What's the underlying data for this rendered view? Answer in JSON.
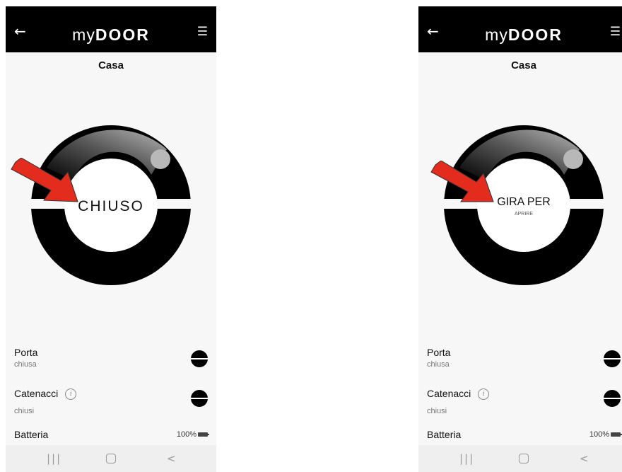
{
  "screens": [
    {
      "header": {
        "logo_lo": "my",
        "logo_hi": "DOOR",
        "back_icon": "arrow-left-icon",
        "menu_icon": "hamburger-menu-icon"
      },
      "title": "Casa",
      "dial": {
        "center_main": "CHIUSO",
        "center_sub": ""
      },
      "status": {
        "door_label": "Porta",
        "door_value": "chiusa",
        "bolts_label": "Catenacci",
        "bolts_value": "chiusi",
        "battery_label": "Batteria",
        "battery_value": "100%"
      }
    },
    {
      "header": {
        "logo_lo": "my",
        "logo_hi": "DOOR",
        "back_icon": "arrow-left-icon",
        "menu_icon": "hamburger-menu-icon"
      },
      "title": "Casa",
      "dial": {
        "center_main": "GIRA PER",
        "center_sub": "APRIRE"
      },
      "status": {
        "door_label": "Porta",
        "door_value": "chiusa",
        "bolts_label": "Catenacci",
        "bolts_value": "chiusi",
        "battery_label": "Batteria",
        "battery_value": "100%"
      }
    }
  ],
  "colors": {
    "annotation_arrow": "#e32b1e",
    "topbar": "#000000",
    "screen_bg": "#f7f7f7"
  }
}
